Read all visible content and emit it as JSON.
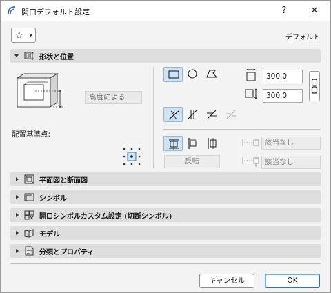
{
  "window": {
    "title": "開口デフォルト設定",
    "help_glyph": "?",
    "close_glyph": "✕"
  },
  "toolbar": {
    "favorites_icon": "star-icon",
    "default_label": "デフォルト"
  },
  "sections": [
    {
      "label": "形状と位置",
      "expanded": true,
      "icon": "shape-position-icon"
    },
    {
      "label": "平面図と断面図",
      "expanded": false,
      "icon": "floor-plan-section-icon"
    },
    {
      "label": "シンボル",
      "expanded": false,
      "icon": "symbol-icon"
    },
    {
      "label": "開口シンボルカスタム設定 (切断シンボル)",
      "expanded": false,
      "icon": "custom-symbol-icon"
    },
    {
      "label": "モデル",
      "expanded": false,
      "icon": "model-icon"
    },
    {
      "label": "分類とプロパティ",
      "expanded": false,
      "icon": "classification-icon"
    }
  ],
  "geometry": {
    "height_mode_placeholder": "高度による",
    "anchor_label": "配置基準点:",
    "width_value": "300.0",
    "height_value": "300.0",
    "flip_label": "反転",
    "offset_none_1": "該当なし",
    "offset_none_2": "該当なし"
  },
  "footer": {
    "cancel_label": "キャンセル",
    "ok_label": "OK"
  },
  "colors": {
    "accent": "#2a6fc9",
    "selected_bg": "#cfe3f7"
  }
}
